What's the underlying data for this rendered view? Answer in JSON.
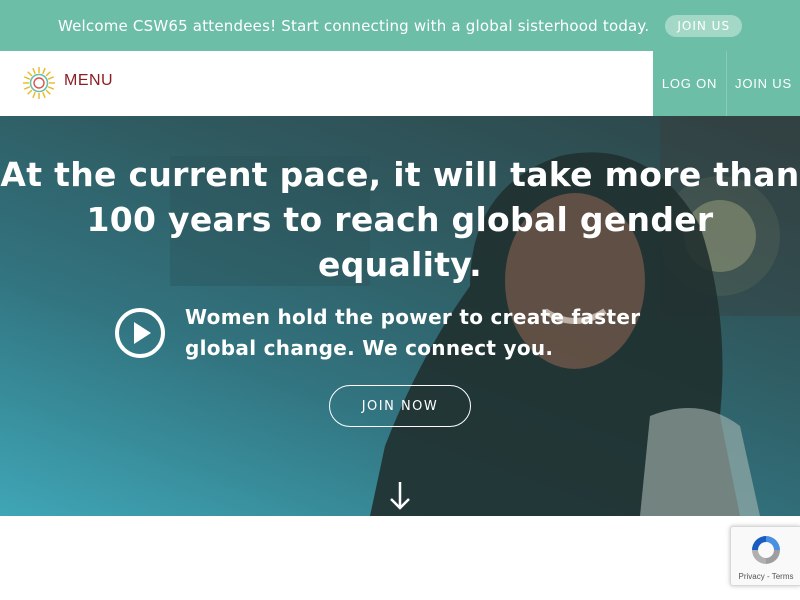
{
  "announcement": {
    "text": "Welcome CSW65 attendees! Start connecting with a global sisterhood today.",
    "button_label": "JOIN US"
  },
  "nav": {
    "menu_label": "MENU",
    "login_label": "LOG ON",
    "join_label": "JOIN US"
  },
  "hero": {
    "title_line1": "At the current pace, it will take more than",
    "title_line2": "100 years to reach global gender equality.",
    "subtitle_line1": "Women hold the power to create faster",
    "subtitle_line2": "global change. We connect you.",
    "cta_label": "JOIN NOW"
  },
  "recaptcha": {
    "privacy_label": "Privacy",
    "separator": " - ",
    "terms_label": "Terms"
  },
  "colors": {
    "accent_green": "#6cbfa6",
    "menu_red": "#8b1e24",
    "hero_teal": "#327480"
  },
  "icons": {
    "logo": "sunburst-logo-icon",
    "play": "play-circle-icon",
    "scroll": "arrow-down-icon",
    "captcha": "recaptcha-icon"
  }
}
